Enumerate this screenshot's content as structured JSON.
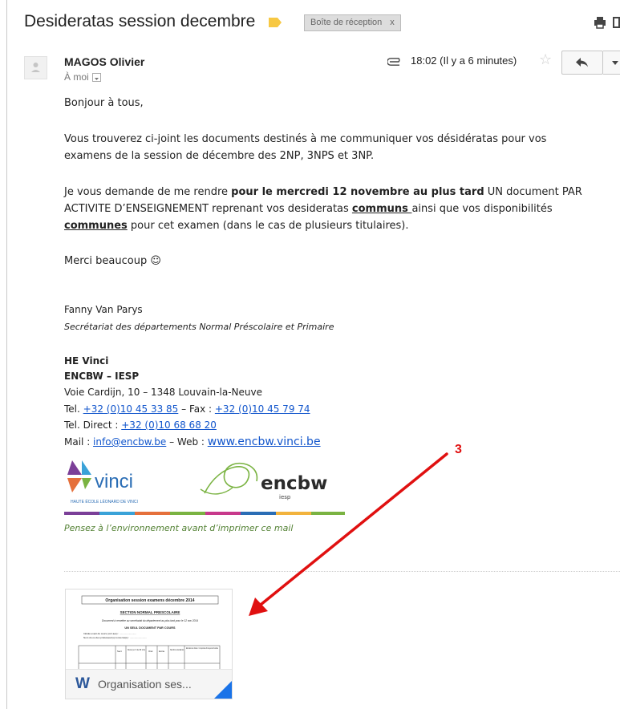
{
  "email": {
    "subject": "Desideratas session decembre",
    "label_chip": "Boîte de réception",
    "label_chip_close": "x",
    "sender": "MAGOS Olivier",
    "to": "À moi",
    "time": "18:02 (Il y a 6 minutes)",
    "body": {
      "greeting": "Bonjour à tous,",
      "para1_line1": "Vous trouverez ci-joint les documents destinés à me communiquer vos désidératas pour vos",
      "para1_line2": "examens de la session de décembre des 2NP, 3NPS et 3NP.",
      "para2_a": "Je vous demande de me rendre ",
      "para2_bold": "pour le mercredi 12 novembre au plus tard",
      "para2_b": " UN document PAR",
      "para2_line2_a": "ACTIVITE D’ENSEIGNEMENT reprenant vos desideratas ",
      "para2_line2_bold": "communs ",
      "para2_line2_b": "ainsi que vos disponibilités",
      "para2_line3_bold": "communes",
      "para2_line3_b": " pour cet examen (dans le cas de plusieurs titulaires).",
      "thanks": "Merci beaucoup ☺"
    },
    "signature": {
      "name": "Fanny Van Parys",
      "role": "Secrétariat des départements Normal Préscolaire et Primaire",
      "org1": "HE Vinci",
      "org2": "ENCBW – IESP",
      "address": "Voie Cardijn, 10 – 1348 Louvain-la-Neuve",
      "tel_label": "Tel. ",
      "tel": "+32 (0)10 45 33 85",
      "fax_label": " – Fax : ",
      "fax": "+32 (0)10 45 79 74",
      "direct_label": "Tel. Direct : ",
      "direct": "+32 (0)10 68 68 20",
      "mail_label": "Mail : ",
      "mail": "info@encbw.be",
      "web_label": " – Web : ",
      "web": "www.encbw.vinci.be",
      "logo_vinci": "vinci",
      "logo_vinci_sub": "HAUTE ÉCOLE LÉONARD DE VINCI",
      "logo_encbw": "encbw",
      "logo_encbw_sub": "iesp",
      "env_note": "Pensez à l’environnement avant d’imprimer ce mail"
    },
    "attachment": {
      "name": "Organisation ses...",
      "preview_title": "Organisation session examens décembre 2014",
      "preview_section": "SECTION NORMAL PRESCOLAIRE",
      "preview_note": "Document à remettre au secrétariat du département au plus tard pour le 12 nov 2014",
      "preview_sub": "UN SEUL DOCUMENT PAR COURS",
      "preview_line1": "Intitulé exact du cours (voir aes) : .........................",
      "preview_line2": "Nom du ou des professeur(s) concerné(s) : .........................",
      "preview_cols": [
        "Sect",
        "Durée (en h de 60 min)",
        "Oral",
        "Ecrite",
        "Nombre étudiants",
        "Estimation de l'étude : C-importante M-moyenne R-réduite"
      ]
    }
  },
  "annotation": {
    "number": "3",
    "color": "#e01010"
  },
  "colors": {
    "link": "#1155cc",
    "env_green": "#548235",
    "label_yellow": "#f7c843",
    "word_blue": "#2b579a"
  }
}
